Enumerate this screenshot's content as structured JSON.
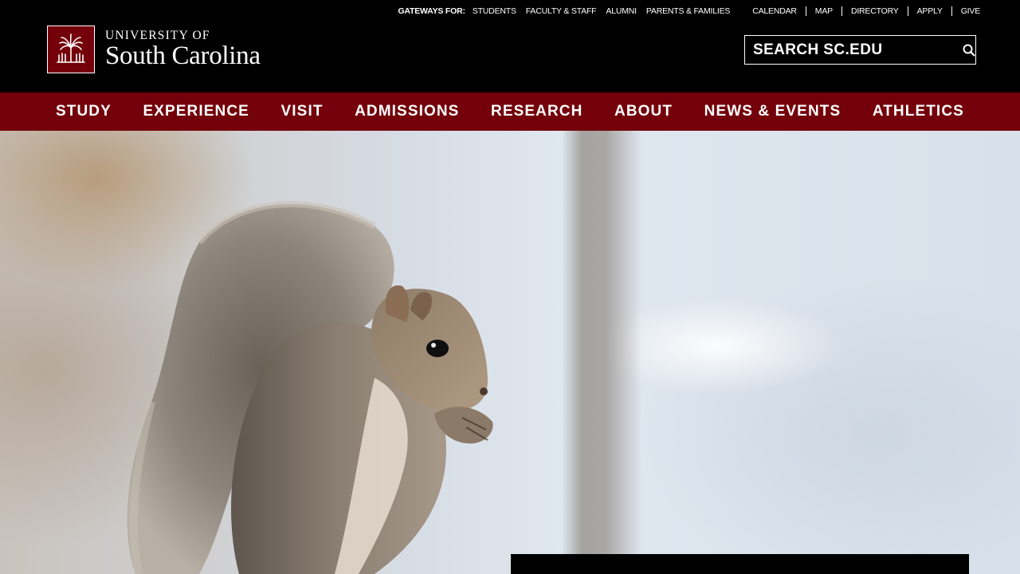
{
  "utility": {
    "gateways_label": "GATEWAYS FOR:",
    "gateways": [
      "STUDENTS",
      "FACULTY & STAFF",
      "ALUMNI",
      "PARENTS & FAMILIES"
    ],
    "tools": [
      "CALENDAR",
      "MAP",
      "DIRECTORY",
      "APPLY",
      "GIVE"
    ]
  },
  "logo": {
    "line1": "UNIVERSITY OF",
    "line2": "South Carolina",
    "icon": "palmetto-tree-icon"
  },
  "search": {
    "placeholder": "SEARCH SC.EDU",
    "icon": "search-icon"
  },
  "nav": [
    "STUDY",
    "EXPERIENCE",
    "VISIT",
    "ADMISSIONS",
    "RESEARCH",
    "ABOUT",
    "NEWS & EVENTS",
    "ATHLETICS"
  ],
  "colors": {
    "garnet": "#73000a",
    "black": "#000000",
    "white": "#ffffff"
  }
}
